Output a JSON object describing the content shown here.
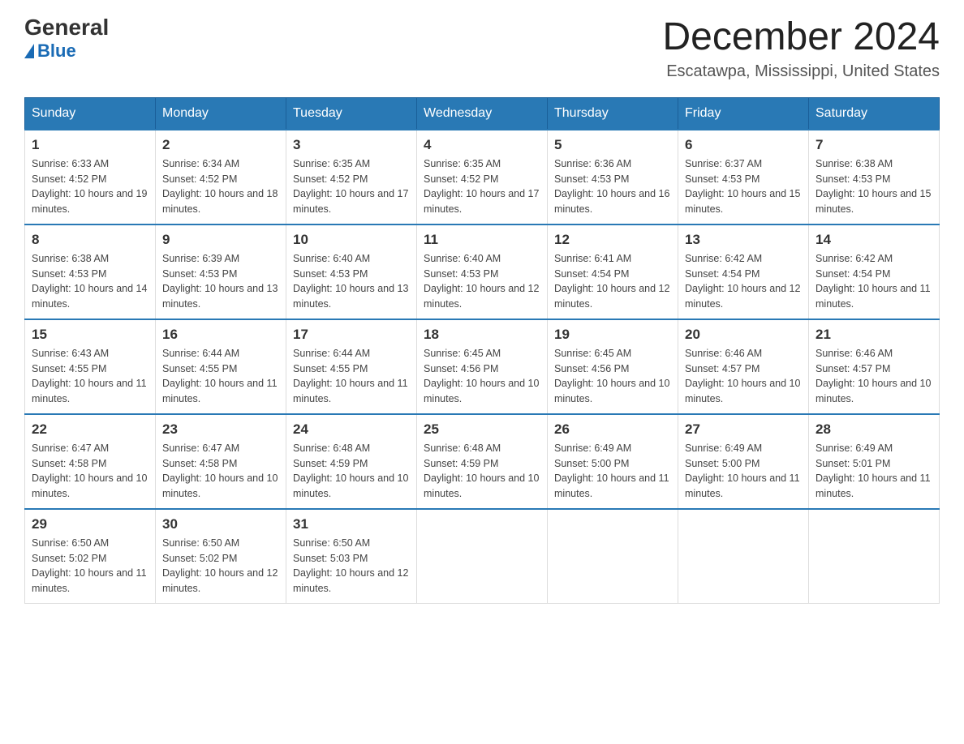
{
  "header": {
    "logo_general": "General",
    "logo_blue": "Blue",
    "month_title": "December 2024",
    "location": "Escatawpa, Mississippi, United States"
  },
  "days_of_week": [
    "Sunday",
    "Monday",
    "Tuesday",
    "Wednesday",
    "Thursday",
    "Friday",
    "Saturday"
  ],
  "weeks": [
    [
      {
        "day": "1",
        "sunrise": "6:33 AM",
        "sunset": "4:52 PM",
        "daylight": "10 hours and 19 minutes."
      },
      {
        "day": "2",
        "sunrise": "6:34 AM",
        "sunset": "4:52 PM",
        "daylight": "10 hours and 18 minutes."
      },
      {
        "day": "3",
        "sunrise": "6:35 AM",
        "sunset": "4:52 PM",
        "daylight": "10 hours and 17 minutes."
      },
      {
        "day": "4",
        "sunrise": "6:35 AM",
        "sunset": "4:52 PM",
        "daylight": "10 hours and 17 minutes."
      },
      {
        "day": "5",
        "sunrise": "6:36 AM",
        "sunset": "4:53 PM",
        "daylight": "10 hours and 16 minutes."
      },
      {
        "day": "6",
        "sunrise": "6:37 AM",
        "sunset": "4:53 PM",
        "daylight": "10 hours and 15 minutes."
      },
      {
        "day": "7",
        "sunrise": "6:38 AM",
        "sunset": "4:53 PM",
        "daylight": "10 hours and 15 minutes."
      }
    ],
    [
      {
        "day": "8",
        "sunrise": "6:38 AM",
        "sunset": "4:53 PM",
        "daylight": "10 hours and 14 minutes."
      },
      {
        "day": "9",
        "sunrise": "6:39 AM",
        "sunset": "4:53 PM",
        "daylight": "10 hours and 13 minutes."
      },
      {
        "day": "10",
        "sunrise": "6:40 AM",
        "sunset": "4:53 PM",
        "daylight": "10 hours and 13 minutes."
      },
      {
        "day": "11",
        "sunrise": "6:40 AM",
        "sunset": "4:53 PM",
        "daylight": "10 hours and 12 minutes."
      },
      {
        "day": "12",
        "sunrise": "6:41 AM",
        "sunset": "4:54 PM",
        "daylight": "10 hours and 12 minutes."
      },
      {
        "day": "13",
        "sunrise": "6:42 AM",
        "sunset": "4:54 PM",
        "daylight": "10 hours and 12 minutes."
      },
      {
        "day": "14",
        "sunrise": "6:42 AM",
        "sunset": "4:54 PM",
        "daylight": "10 hours and 11 minutes."
      }
    ],
    [
      {
        "day": "15",
        "sunrise": "6:43 AM",
        "sunset": "4:55 PM",
        "daylight": "10 hours and 11 minutes."
      },
      {
        "day": "16",
        "sunrise": "6:44 AM",
        "sunset": "4:55 PM",
        "daylight": "10 hours and 11 minutes."
      },
      {
        "day": "17",
        "sunrise": "6:44 AM",
        "sunset": "4:55 PM",
        "daylight": "10 hours and 11 minutes."
      },
      {
        "day": "18",
        "sunrise": "6:45 AM",
        "sunset": "4:56 PM",
        "daylight": "10 hours and 10 minutes."
      },
      {
        "day": "19",
        "sunrise": "6:45 AM",
        "sunset": "4:56 PM",
        "daylight": "10 hours and 10 minutes."
      },
      {
        "day": "20",
        "sunrise": "6:46 AM",
        "sunset": "4:57 PM",
        "daylight": "10 hours and 10 minutes."
      },
      {
        "day": "21",
        "sunrise": "6:46 AM",
        "sunset": "4:57 PM",
        "daylight": "10 hours and 10 minutes."
      }
    ],
    [
      {
        "day": "22",
        "sunrise": "6:47 AM",
        "sunset": "4:58 PM",
        "daylight": "10 hours and 10 minutes."
      },
      {
        "day": "23",
        "sunrise": "6:47 AM",
        "sunset": "4:58 PM",
        "daylight": "10 hours and 10 minutes."
      },
      {
        "day": "24",
        "sunrise": "6:48 AM",
        "sunset": "4:59 PM",
        "daylight": "10 hours and 10 minutes."
      },
      {
        "day": "25",
        "sunrise": "6:48 AM",
        "sunset": "4:59 PM",
        "daylight": "10 hours and 10 minutes."
      },
      {
        "day": "26",
        "sunrise": "6:49 AM",
        "sunset": "5:00 PM",
        "daylight": "10 hours and 11 minutes."
      },
      {
        "day": "27",
        "sunrise": "6:49 AM",
        "sunset": "5:00 PM",
        "daylight": "10 hours and 11 minutes."
      },
      {
        "day": "28",
        "sunrise": "6:49 AM",
        "sunset": "5:01 PM",
        "daylight": "10 hours and 11 minutes."
      }
    ],
    [
      {
        "day": "29",
        "sunrise": "6:50 AM",
        "sunset": "5:02 PM",
        "daylight": "10 hours and 11 minutes."
      },
      {
        "day": "30",
        "sunrise": "6:50 AM",
        "sunset": "5:02 PM",
        "daylight": "10 hours and 12 minutes."
      },
      {
        "day": "31",
        "sunrise": "6:50 AM",
        "sunset": "5:03 PM",
        "daylight": "10 hours and 12 minutes."
      },
      null,
      null,
      null,
      null
    ]
  ]
}
